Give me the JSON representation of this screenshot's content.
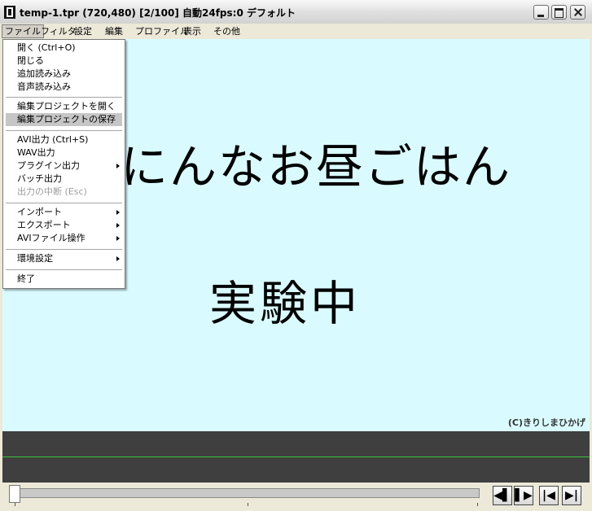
{
  "window": {
    "title": "temp-1.tpr (720,480) [2/100] 自動24fps:0 デフォルト"
  },
  "menubar": {
    "items": [
      "ファイル",
      "フィルタ",
      "設定",
      "編集",
      "プロファイル",
      "表示",
      "その他"
    ]
  },
  "file_menu": {
    "groups": [
      [
        "開く (Ctrl+O)",
        "閉じる",
        "追加読み込み",
        "音声読み込み"
      ],
      [
        "編集プロジェクトを開く",
        "編集プロジェクトの保存"
      ],
      [
        "AVI出力 (Ctrl+S)",
        "WAV出力",
        "プラグイン出力",
        "バッチ出力",
        "出力の中断 (Esc)"
      ],
      [
        "インポート",
        "エクスポート",
        "AVIファイル操作"
      ],
      [
        "環境設定"
      ],
      [
        "終了"
      ]
    ],
    "selected": "編集プロジェクトの保存",
    "disabled": [
      "出力の中断 (Esc)"
    ],
    "submenus": [
      "プラグイン出力",
      "インポート",
      "エクスポート",
      "AVIファイル操作",
      "環境設定"
    ]
  },
  "canvas": {
    "line1": "にんなお昼ごはん",
    "line2": "実験中",
    "credit": "(C)きりしまひかげ",
    "background": "#d9fbff"
  },
  "controls": {
    "prev_frame": "◀▌",
    "next_frame": "▌▶",
    "jump_start": "|◀",
    "jump_end": "▶|"
  }
}
